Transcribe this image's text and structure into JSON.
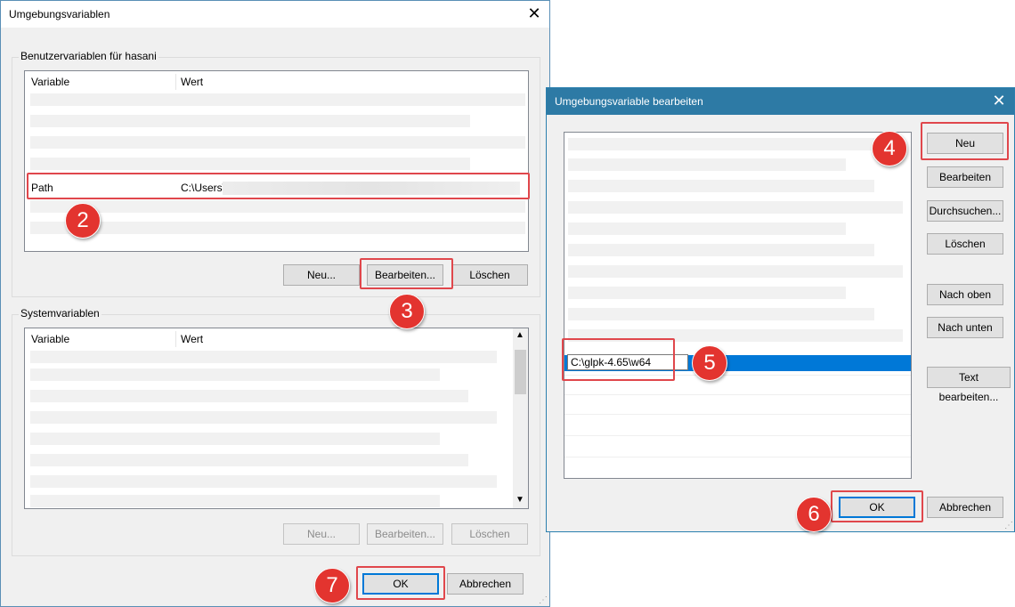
{
  "main_dialog": {
    "title": "Umgebungsvariablen",
    "user_group": {
      "label": "Benutzervariablen für hasani",
      "columns": [
        "Variable",
        "Wert"
      ],
      "path_row": {
        "variable": "Path",
        "value": "C:\\Users\\"
      },
      "buttons": {
        "new": "Neu...",
        "edit": "Bearbeiten...",
        "delete": "Löschen"
      }
    },
    "system_group": {
      "label": "Systemvariablen",
      "columns": [
        "Variable",
        "Wert"
      ],
      "buttons": {
        "new": "Neu...",
        "edit": "Bearbeiten...",
        "delete": "Löschen"
      }
    },
    "ok": "OK",
    "cancel": "Abbrechen"
  },
  "edit_dialog": {
    "title": "Umgebungsvariable bearbeiten",
    "editing_value": "C:\\glpk-4.65\\w64",
    "buttons": {
      "new": "Neu",
      "edit": "Bearbeiten",
      "browse": "Durchsuchen...",
      "delete": "Löschen",
      "move_up": "Nach oben",
      "move_down": "Nach unten",
      "edit_text": "Text bearbeiten..."
    },
    "ok": "OK",
    "cancel": "Abbrechen"
  },
  "steps": [
    "2",
    "3",
    "4",
    "5",
    "6",
    "7"
  ],
  "colors": {
    "highlight": "#e0474c",
    "badge": "#e3342f",
    "selection": "#0078d7",
    "titlebar_active": "#2d7aa5"
  }
}
